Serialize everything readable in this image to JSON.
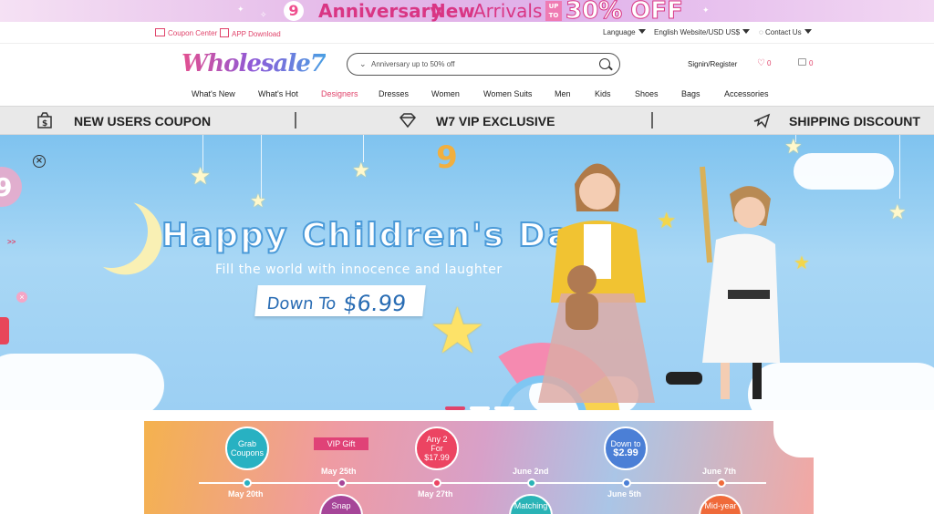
{
  "top_banner": {
    "logo_digit": "9",
    "word1": "Anniversary",
    "word2": "New",
    "word3": "Arrivals",
    "upto": "UP TO",
    "discount": "30% OFF"
  },
  "util": {
    "coupon_center": "Coupon Center",
    "app_download": "APP Download",
    "language": "Language",
    "website": "English Website/USD US$",
    "contact": "Contact Us"
  },
  "logo": "Wholesale7",
  "search": {
    "placeholder": "Anniversary up to 50% off"
  },
  "account": {
    "signin": "Signin/Register",
    "wishlist_count": "0",
    "cart_count": "0"
  },
  "nav": [
    "What's New",
    "What's Hot",
    "Designers",
    "Dresses",
    "Women",
    "Women Suits",
    "Men",
    "Kids",
    "Shoes",
    "Bags",
    "Accessories"
  ],
  "promo": {
    "new_users": "NEW USERS COUPON",
    "vip": "W7 VIP EXCLUSIVE",
    "shipping": "SHIPPING DISCOUNT"
  },
  "hero": {
    "badge": "9",
    "title": "Happy Children's Day",
    "subtitle": "Fill the world with innocence and laughter",
    "price_prefix": "Down To",
    "price": "$6.99",
    "side_arrow": ">>"
  },
  "timeline": {
    "vip_gift": "VIP Gift",
    "circles": [
      {
        "label1": "Grab",
        "label2": "Coupons",
        "label3": ""
      },
      {
        "label1": "Any 2",
        "label2": "For",
        "label3": "$17.99"
      },
      {
        "label1": "Down to",
        "label2": "$2.99",
        "label3": ""
      },
      {
        "label1": "Snap",
        "label2": "",
        "label3": ""
      },
      {
        "label1": "Matching",
        "label2": "",
        "label3": ""
      },
      {
        "label1": "Mid-year",
        "label2": "",
        "label3": ""
      }
    ],
    "dates": [
      "May 20th",
      "May 25th",
      "May 27th",
      "June 2nd",
      "June 5th",
      "June 7th"
    ]
  },
  "colors": {
    "accent": "#e0446b",
    "hero_sky": "#8fcbf1",
    "promo_bar": "#e9e9e9"
  }
}
